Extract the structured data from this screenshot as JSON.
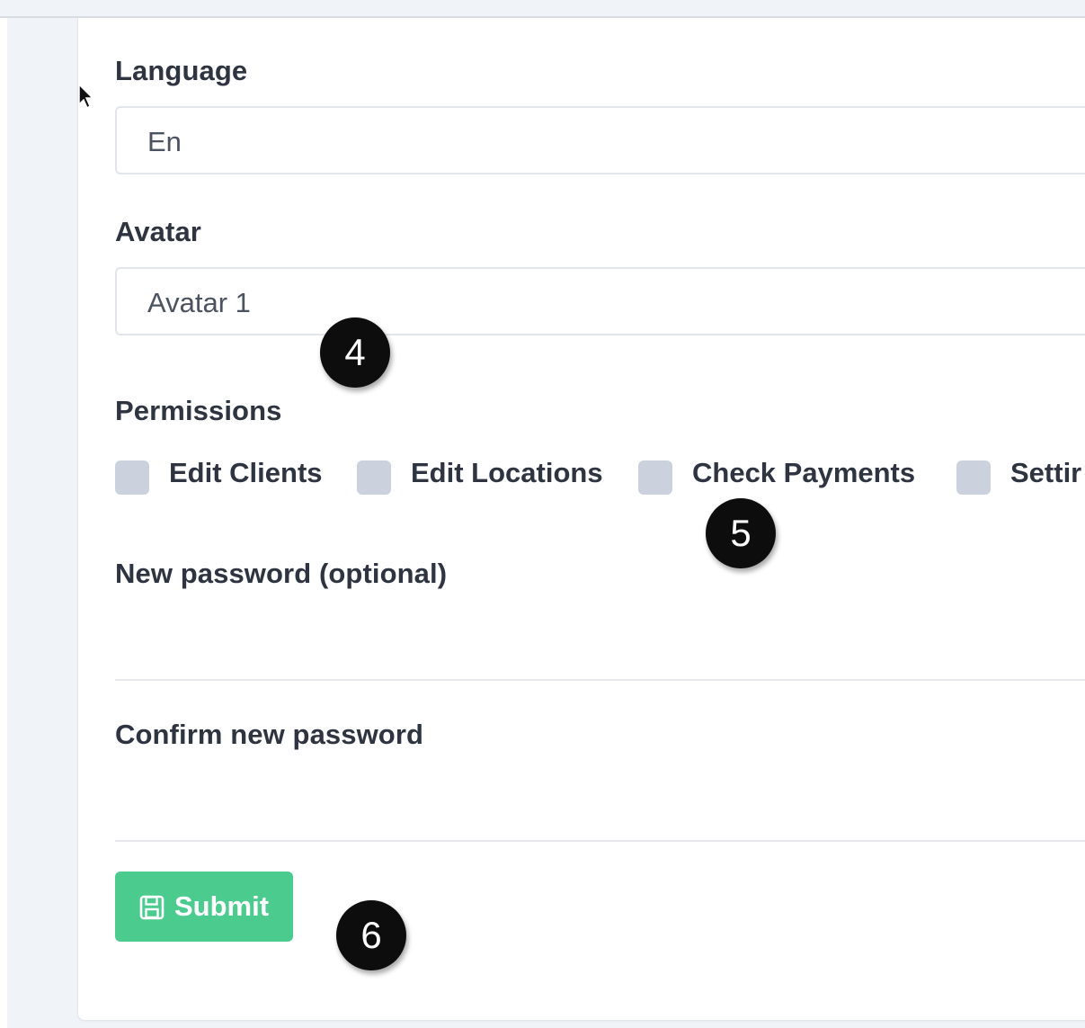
{
  "form": {
    "language": {
      "label": "Language",
      "value": "En"
    },
    "avatar": {
      "label": "Avatar",
      "value": "Avatar 1"
    },
    "permissions": {
      "label": "Permissions",
      "items": [
        {
          "label": "Edit Clients",
          "checked": false
        },
        {
          "label": "Edit Locations",
          "checked": false
        },
        {
          "label": "Check Payments",
          "checked": false
        },
        {
          "label": "Settir",
          "checked": false
        }
      ]
    },
    "new_password": {
      "label": "New password (optional)",
      "value": ""
    },
    "confirm_password": {
      "label": "Confirm new password",
      "value": ""
    },
    "submit": {
      "label": "Submit",
      "icon": "save-icon",
      "color": "#4ccb8f"
    }
  },
  "annotations": [
    {
      "number": "4"
    },
    {
      "number": "5"
    },
    {
      "number": "6"
    }
  ]
}
